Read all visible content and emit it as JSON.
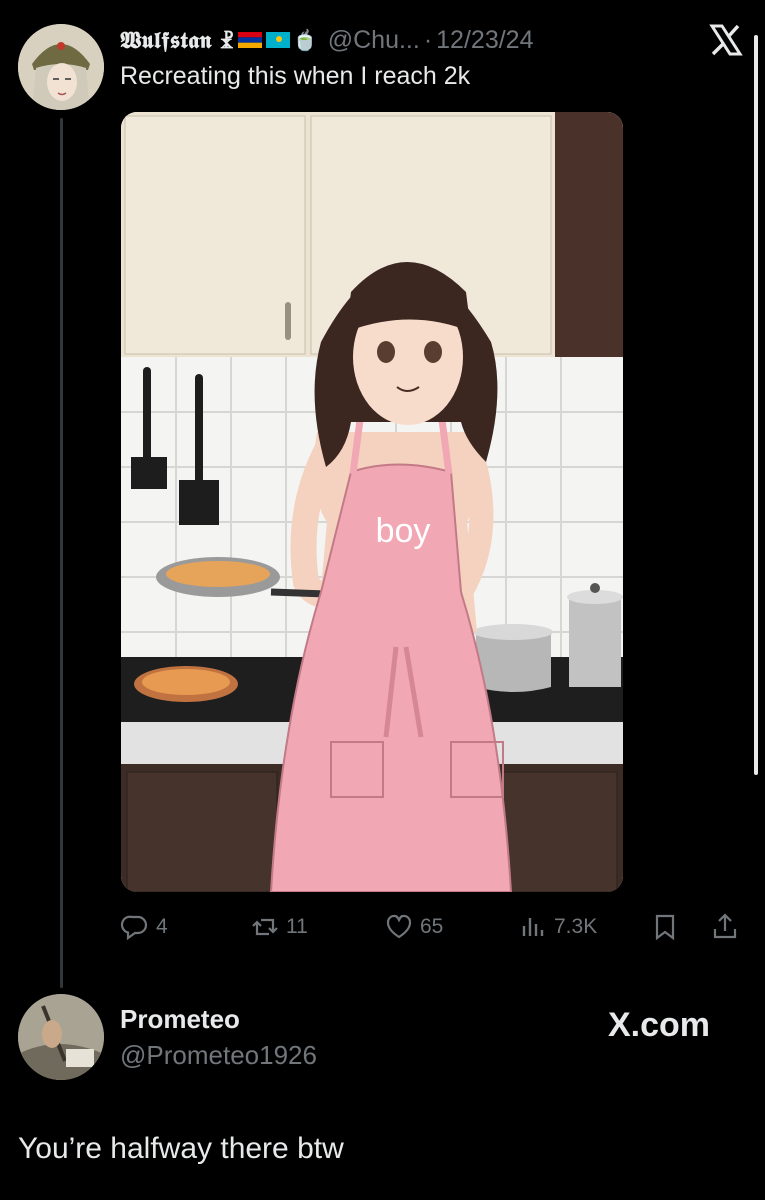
{
  "tweet": {
    "display_name": "𝖂𝖚𝖑𝖋𝖘𝖙𝖆𝖓 ☧",
    "flags": [
      "armenia-flag",
      "kazakhstan-flag"
    ],
    "extra_emoji": "🍵",
    "handle": "@Chu...",
    "separator": "·",
    "date": "12/23/24",
    "text": "Recreating this when I reach 2k",
    "image_apron_text": "boy",
    "stats": {
      "replies": "4",
      "retweets": "11",
      "likes": "65",
      "views": "7.3K"
    }
  },
  "reply": {
    "display_name": "Prometeo",
    "handle": "@Prometeo1926",
    "text": "You’re halfway there btw"
  },
  "watermark": "X.com",
  "colors": {
    "background": "#000000",
    "text": "#e7e9ea",
    "muted": "#71767b",
    "apron": "#f2a7b4"
  }
}
